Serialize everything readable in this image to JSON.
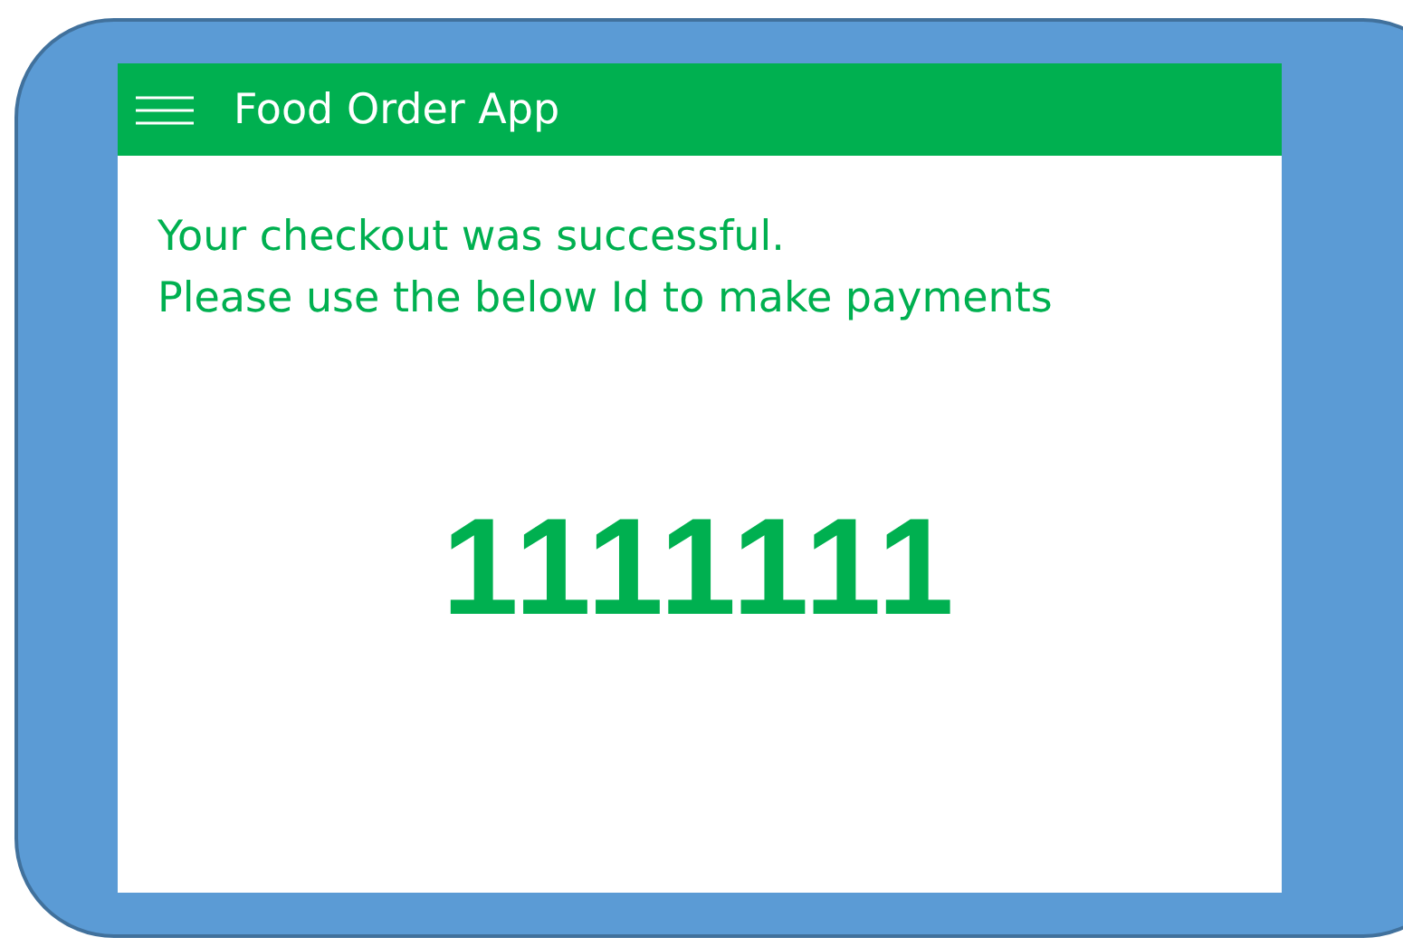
{
  "app_bar": {
    "title": "Food Order App"
  },
  "message": [
    "Your checkout was successful.",
    "Please use the below Id to make payments"
  ],
  "payment_id": "1111111"
}
